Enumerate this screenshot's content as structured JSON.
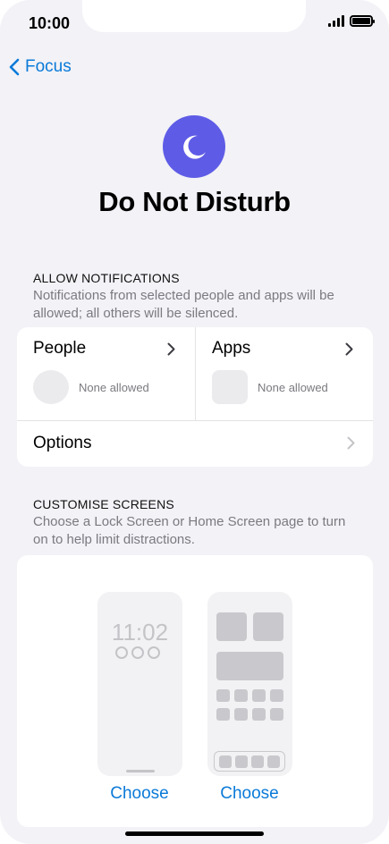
{
  "status_bar": {
    "time": "10:00"
  },
  "nav": {
    "back_label": "Focus"
  },
  "header": {
    "icon": "moon-icon",
    "icon_color": "#5e5ce6",
    "title": "Do Not Disturb"
  },
  "allow_notifications": {
    "header": "ALLOW NOTIFICATIONS",
    "description": "Notifications from selected people and apps will be allowed; all others will be silenced.",
    "people": {
      "label": "People",
      "status": "None allowed"
    },
    "apps": {
      "label": "Apps",
      "status": "None allowed"
    },
    "options_label": "Options"
  },
  "customise_screens": {
    "header": "CUSTOMISE SCREENS",
    "description": "Choose a Lock Screen or Home Screen page to turn on to help limit distractions.",
    "lock_screen_time": "11:02",
    "lock_choose_label": "Choose",
    "home_choose_label": "Choose"
  },
  "colors": {
    "accent": "#0a7ad8",
    "background": "#f2f2f7",
    "secondary_text": "#7a7a80"
  }
}
